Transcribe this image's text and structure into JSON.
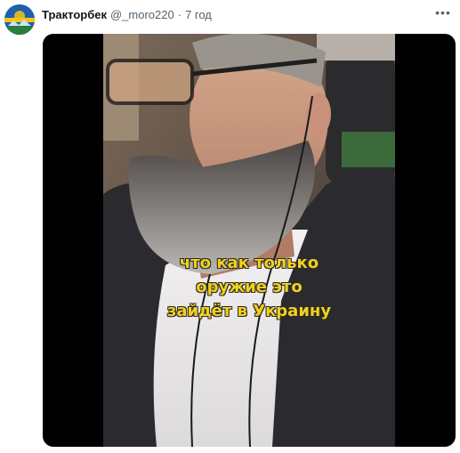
{
  "tweet": {
    "author_name": "Тракторбек",
    "handle": "@_moro220",
    "separator": "·",
    "time": "7 год",
    "more_label": "•••"
  },
  "video": {
    "caption_lines": [
      "что как только",
      "оружие это",
      "зайдёт в Украину"
    ]
  },
  "colors": {
    "caption_text": "#f2d01a",
    "media_background": "#000000",
    "avatar_blue": "#1e5fae",
    "avatar_yellow": "#f5c518"
  }
}
